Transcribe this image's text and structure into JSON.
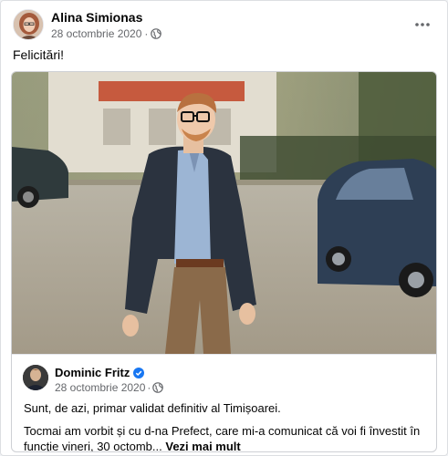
{
  "post": {
    "author": "Alina Simionas",
    "date": "28 octombrie 2020",
    "separator": "·",
    "privacy_icon": "globe-icon",
    "more_icon": "more-options-icon",
    "text": "Felicitări!"
  },
  "shared": {
    "author": "Dominic Fritz",
    "verified_icon": "verified-badge-icon",
    "date": "28 octombrie 2020",
    "separator": "·",
    "privacy_icon": "globe-icon",
    "line1": "Sunt, de azi, primar validat definitiv al Timișoarei.",
    "line2": "Tocmai am vorbit și cu d-na Prefect, care mi-a comunicat că voi fi învestit în funcție vineri, 30 octomb...",
    "see_more": "Vezi mai mult"
  },
  "colors": {
    "accent": "#1877f2",
    "secondary_text": "#65676b",
    "primary_text": "#050505"
  }
}
